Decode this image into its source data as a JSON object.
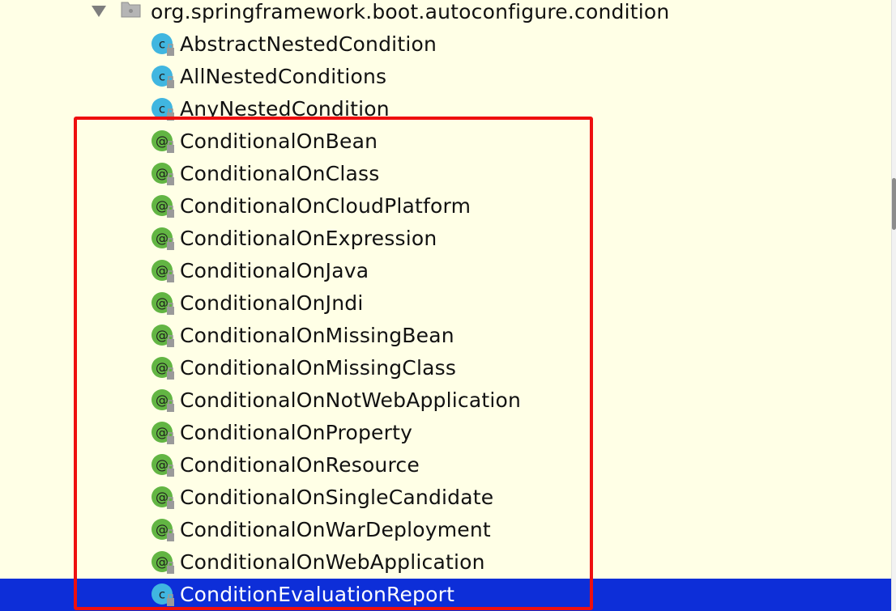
{
  "tree": {
    "package": {
      "label": "org.springframework.boot.autoconfigure.condition",
      "icon": "package-icon",
      "expanded": true
    },
    "items": [
      {
        "label": "AbstractNestedCondition",
        "icon": "class-icon",
        "kind": "class"
      },
      {
        "label": "AllNestedConditions",
        "icon": "class-icon",
        "kind": "class"
      },
      {
        "label": "AnyNestedCondition",
        "icon": "class-icon",
        "kind": "class"
      },
      {
        "label": "ConditionalOnBean",
        "icon": "annotation-icon",
        "kind": "annotation"
      },
      {
        "label": "ConditionalOnClass",
        "icon": "annotation-icon",
        "kind": "annotation"
      },
      {
        "label": "ConditionalOnCloudPlatform",
        "icon": "annotation-icon",
        "kind": "annotation"
      },
      {
        "label": "ConditionalOnExpression",
        "icon": "annotation-icon",
        "kind": "annotation"
      },
      {
        "label": "ConditionalOnJava",
        "icon": "annotation-icon",
        "kind": "annotation"
      },
      {
        "label": "ConditionalOnJndi",
        "icon": "annotation-icon",
        "kind": "annotation"
      },
      {
        "label": "ConditionalOnMissingBean",
        "icon": "annotation-icon",
        "kind": "annotation"
      },
      {
        "label": "ConditionalOnMissingClass",
        "icon": "annotation-icon",
        "kind": "annotation"
      },
      {
        "label": "ConditionalOnNotWebApplication",
        "icon": "annotation-icon",
        "kind": "annotation"
      },
      {
        "label": "ConditionalOnProperty",
        "icon": "annotation-icon",
        "kind": "annotation"
      },
      {
        "label": "ConditionalOnResource",
        "icon": "annotation-icon",
        "kind": "annotation"
      },
      {
        "label": "ConditionalOnSingleCandidate",
        "icon": "annotation-icon",
        "kind": "annotation"
      },
      {
        "label": "ConditionalOnWarDeployment",
        "icon": "annotation-icon",
        "kind": "annotation"
      },
      {
        "label": "ConditionalOnWebApplication",
        "icon": "annotation-icon",
        "kind": "annotation"
      },
      {
        "label": "ConditionEvaluationReport",
        "icon": "class-icon",
        "kind": "class",
        "selected": true
      }
    ]
  },
  "colors": {
    "background": "#FFFFE6",
    "selection": "#0D2ED8",
    "highlight_box": "#EE0F0F",
    "annotation_icon": "#62B543",
    "class_icon": "#40B6E0"
  }
}
